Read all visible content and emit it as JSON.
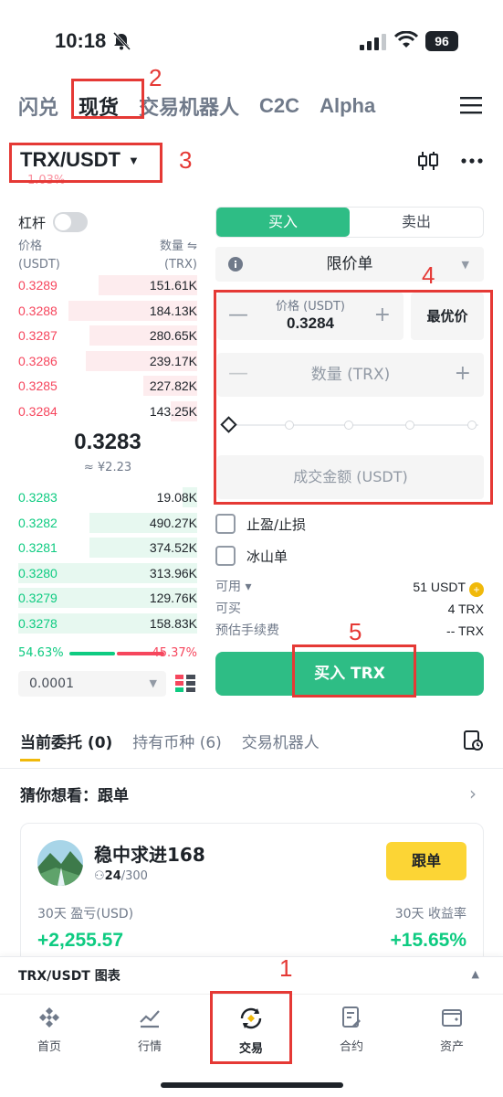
{
  "status": {
    "time": "10:18",
    "battery": "96"
  },
  "top_tabs": [
    "闪兑",
    "现货",
    "交易机器人",
    "C2C",
    "Alpha"
  ],
  "pair": {
    "name": "TRX/USDT",
    "change": "1.03%"
  },
  "leverage_label": "杠杆",
  "orderbook": {
    "price_header": "价格",
    "price_unit": "(USDT)",
    "qty_header": "数量 ⇋",
    "qty_unit": "(TRX)",
    "asks": [
      {
        "price": "0.3289",
        "qty": "151.61K",
        "depth": 0.55
      },
      {
        "price": "0.3288",
        "qty": "184.13K",
        "depth": 0.72
      },
      {
        "price": "0.3287",
        "qty": "280.65K",
        "depth": 0.6
      },
      {
        "price": "0.3286",
        "qty": "239.17K",
        "depth": 0.62
      },
      {
        "price": "0.3285",
        "qty": "227.82K",
        "depth": 0.3
      },
      {
        "price": "0.3284",
        "qty": "143.25K",
        "depth": 0.15
      }
    ],
    "last_price": "0.3283",
    "last_price_cny": "≈ ¥2.23",
    "bids": [
      {
        "price": "0.3283",
        "qty": "19.08K",
        "depth": 0.08
      },
      {
        "price": "0.3282",
        "qty": "490.27K",
        "depth": 0.6
      },
      {
        "price": "0.3281",
        "qty": "374.52K",
        "depth": 0.6
      },
      {
        "price": "0.3280",
        "qty": "313.96K",
        "depth": 1.0
      },
      {
        "price": "0.3279",
        "qty": "129.76K",
        "depth": 1.0
      },
      {
        "price": "0.3278",
        "qty": "158.83K",
        "depth": 1.0
      }
    ],
    "buy_ratio": "54.63%",
    "sell_ratio": "45.37%",
    "precision": "0.0001"
  },
  "form": {
    "buy_tab": "买入",
    "sell_tab": "卖出",
    "order_type": "限价单",
    "price_label": "价格 (USDT)",
    "price_value": "0.3284",
    "best_price": "最优价",
    "qty_placeholder": "数量 (TRX)",
    "amount_placeholder": "成交金额 (USDT)",
    "tp_sl": "止盈/止损",
    "iceberg": "冰山单",
    "available_label": "可用 ▾",
    "available_value": "51 USDT",
    "can_buy_label": "可买",
    "can_buy_value": "4 TRX",
    "fee_label": "预估手续费",
    "fee_value": "-- TRX",
    "buy_button": "买入 TRX"
  },
  "orders_tabs": [
    "当前委托 (0)",
    "持有币种 (6)",
    "交易机器人"
  ],
  "suggestion": {
    "title": "猜你想看：跟单",
    "name": "稳中求进168",
    "followers_current": "24",
    "followers_total": "/300",
    "follow_button": "跟单",
    "pnl_label": "30天 盈亏(USD)",
    "pnl_value": "+2,255.57",
    "roi_label": "30天 收益率",
    "roi_value": "+15.65%"
  },
  "chart_bar": "TRX/USDT 图表",
  "nav": [
    "首页",
    "行情",
    "交易",
    "合约",
    "资产"
  ],
  "annotations": [
    "1",
    "2",
    "3",
    "4",
    "5"
  ],
  "colors": {
    "buy": "#2ebd85",
    "sell": "#f6465d",
    "accent": "#f0b90b",
    "annotation": "#e53935"
  }
}
